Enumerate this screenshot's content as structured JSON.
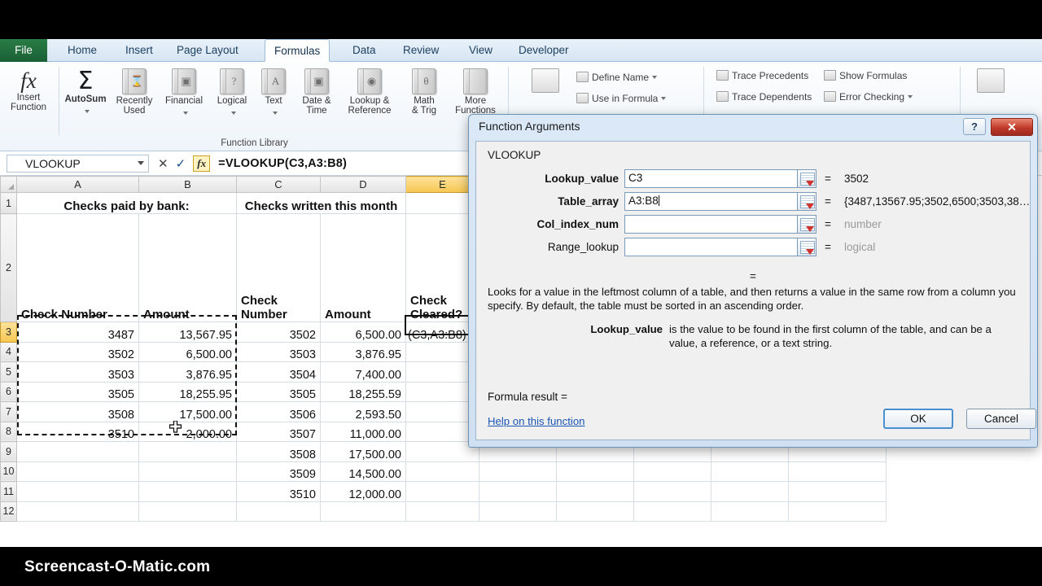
{
  "watermark": "Screencast-O-Matic.com",
  "ribbon": {
    "tabs": [
      {
        "label": "File",
        "active": false
      },
      {
        "label": "Home",
        "active": false
      },
      {
        "label": "Insert",
        "active": false
      },
      {
        "label": "Page Layout",
        "active": false
      },
      {
        "label": "Formulas",
        "active": true
      },
      {
        "label": "Data",
        "active": false
      },
      {
        "label": "Review",
        "active": false
      },
      {
        "label": "View",
        "active": false
      },
      {
        "label": "Developer",
        "active": false
      }
    ],
    "function_library": {
      "group_label": "Function Library",
      "buttons": [
        {
          "label_line1": "Insert",
          "label_line2": "Function",
          "glyph": "fx"
        },
        {
          "label_line1": "AutoSum",
          "label_line2": "",
          "glyph": "sigma"
        },
        {
          "label_line1": "Recently",
          "label_line2": "Used",
          "glyph": "⌛"
        },
        {
          "label_line1": "Financial",
          "label_line2": "",
          "glyph": "⎙"
        },
        {
          "label_line1": "Logical",
          "label_line2": "",
          "glyph": "?"
        },
        {
          "label_line1": "Text",
          "label_line2": "",
          "glyph": "A"
        },
        {
          "label_line1": "Date &",
          "label_line2": "Time",
          "glyph": "◷"
        },
        {
          "label_line1": "Lookup &",
          "label_line2": "Reference",
          "glyph": "○"
        },
        {
          "label_line1": "Math",
          "label_line2": "& Trig",
          "glyph": "θ"
        },
        {
          "label_line1": "More",
          "label_line2": "Functions",
          "glyph": ""
        }
      ]
    },
    "defined_names": [
      {
        "label": "Define Name",
        "has_arrow": true
      },
      {
        "label": "Use in Formula",
        "has_arrow": true
      }
    ],
    "formula_auditing": [
      {
        "label": "Trace Precedents"
      },
      {
        "label": "Show Formulas"
      },
      {
        "label": "Trace Dependents"
      },
      {
        "label": "Error Checking",
        "has_arrow": true
      }
    ]
  },
  "formula_bar": {
    "name_box_value": "VLOOKUP",
    "cancel_icon": "✕",
    "enter_icon": "✓",
    "fx_label": "fx",
    "formula": "=VLOOKUP(C3,A3:B8)"
  },
  "grid": {
    "columns": [
      "A",
      "B",
      "C",
      "D",
      "E"
    ],
    "selected_column": "E",
    "selected_row": "3",
    "rows": [
      {
        "n": "1",
        "a": "Checks paid by bank:",
        "b": "",
        "c": "Checks written this month",
        "d": "",
        "e": ""
      },
      {
        "n": "2",
        "a": "Check Number",
        "b": "Amount",
        "c": "Check Number",
        "d": "Amount",
        "e": "Check Cleared?"
      },
      {
        "n": "3",
        "a": "3487",
        "b": "13,567.95",
        "c": "3502",
        "d": "6,500.00",
        "e": "(C3,A3:B8)"
      },
      {
        "n": "4",
        "a": "3502",
        "b": "6,500.00",
        "c": "3503",
        "d": "3,876.95",
        "e": ""
      },
      {
        "n": "5",
        "a": "3503",
        "b": "3,876.95",
        "c": "3504",
        "d": "7,400.00",
        "e": ""
      },
      {
        "n": "6",
        "a": "3505",
        "b": "18,255.95",
        "c": "3505",
        "d": "18,255.59",
        "e": ""
      },
      {
        "n": "7",
        "a": "3508",
        "b": "17,500.00",
        "c": "3506",
        "d": "2,593.50",
        "e": ""
      },
      {
        "n": "8",
        "a": "3510",
        "b": "2,000.00",
        "c": "3507",
        "d": "11,000.00",
        "e": ""
      },
      {
        "n": "9",
        "a": "",
        "b": "",
        "c": "3508",
        "d": "17,500.00",
        "e": ""
      },
      {
        "n": "10",
        "a": "",
        "b": "",
        "c": "3509",
        "d": "14,500.00",
        "e": ""
      },
      {
        "n": "11",
        "a": "",
        "b": "",
        "c": "3510",
        "d": "12,000.00",
        "e": ""
      },
      {
        "n": "12",
        "a": "",
        "b": "",
        "c": "",
        "d": "",
        "e": ""
      }
    ],
    "marching_ants_range": "A3:B8",
    "active_cell": "E3"
  },
  "dialog": {
    "title": "Function Arguments",
    "help_button": "?",
    "close_button": "✕",
    "function_name": "VLOOKUP",
    "args": [
      {
        "label": "Lookup_value",
        "bold": true,
        "value": "C3",
        "result": "3502",
        "result_gray": false,
        "has_caret": false
      },
      {
        "label": "Table_array",
        "bold": true,
        "value": "A3:B8",
        "result": "{3487,13567.95;3502,6500;3503,38…",
        "result_gray": false,
        "has_caret": true
      },
      {
        "label": "Col_index_num",
        "bold": true,
        "value": "",
        "result": "number",
        "result_gray": true,
        "has_caret": false
      },
      {
        "label": "Range_lookup",
        "bold": false,
        "value": "",
        "result": "logical",
        "result_gray": true,
        "has_caret": false
      }
    ],
    "equals_symbol": "=",
    "mid_equals": "=",
    "description": "Looks for a value in the leftmost column of a table, and then returns a value in the same row from a column you specify. By default, the table must be sorted in an ascending order.",
    "arg_help_name": "Lookup_value",
    "arg_help_text": "is the value to be found in the first column of the table, and can be a value, a reference, or a text string.",
    "formula_result_label": "Formula result =",
    "formula_result_value": "",
    "help_link": "Help on this function",
    "ok_label": "OK",
    "cancel_label": "Cancel"
  },
  "colors": {
    "excel_green": "#1e6e3c",
    "selection_yellow": "#f7c652",
    "dialog_blue": "#cfe0f2",
    "close_red": "#c0392b",
    "link_blue": "#1a55b5"
  }
}
